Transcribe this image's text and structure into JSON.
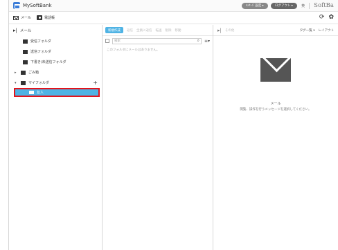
{
  "app": {
    "title": "MySoftBank",
    "brand": "SoftBa",
    "pill_primary": "ﾒｯｾｰｼﾞ設定 ▸",
    "pill_logout": "ログアウト ▸",
    "lang": "英",
    "refresh_glyph": "⟳",
    "settings_glyph": "✿"
  },
  "tabs": [
    {
      "label": "メール"
    },
    {
      "label": "電話帳"
    }
  ],
  "sidebar": {
    "header": "メール",
    "folders": [
      {
        "label": "受信フォルダ"
      },
      {
        "label": "送信フォルダ"
      },
      {
        "label": "下書き/未送信フォルダ"
      },
      {
        "label": "ごみ箱"
      },
      {
        "label": "マイフォルダ"
      }
    ],
    "selected_subfolder": "友人",
    "add_symbol": "+"
  },
  "list": {
    "new_button": "新規作成",
    "toolbar": [
      "返信",
      "全員に返信",
      "転送",
      "削除",
      "移動",
      "その他"
    ],
    "search_placeholder": "検索",
    "empty_message": "このフォルダにメールはありません。"
  },
  "preview": {
    "toolbar_left": "▸|",
    "toolbar_tags": "タグ一覧 ▾",
    "toolbar_layout": "レイアウト",
    "title": "メール",
    "subtitle": "閲覧、操作を行うメッセージを選択してください。"
  },
  "colors": {
    "accent": "#4fb3e4",
    "highlight_border": "#e3141c",
    "icon_dark": "#555555"
  }
}
